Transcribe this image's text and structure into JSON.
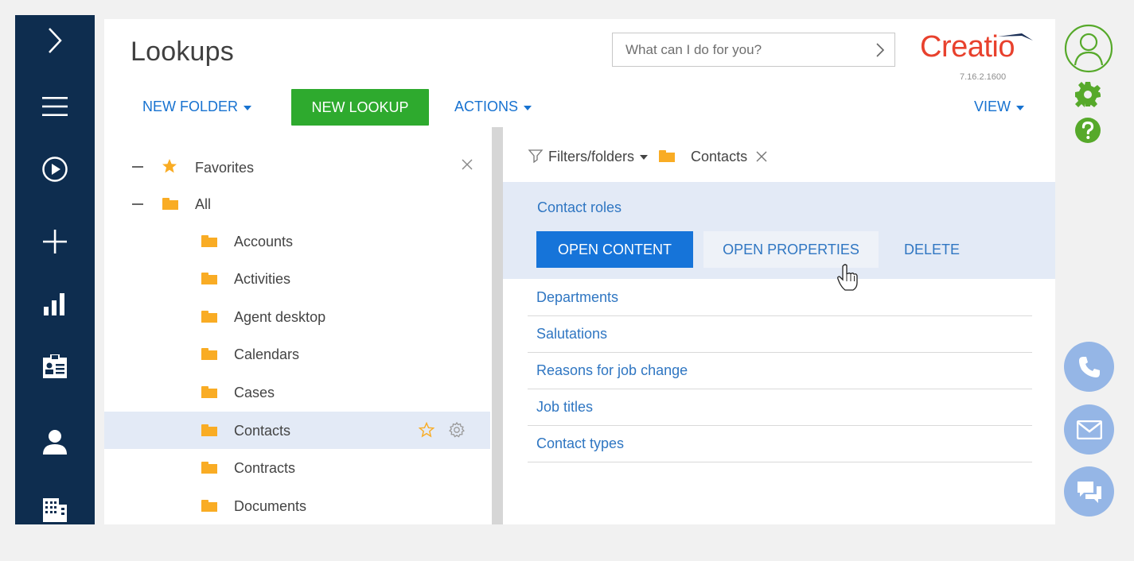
{
  "sidebar_left": {
    "items": [
      {
        "icon": "chevron-right-icon"
      },
      {
        "icon": "hamburger-menu-icon"
      },
      {
        "icon": "play-circle-icon"
      },
      {
        "icon": "plus-icon"
      },
      {
        "icon": "bar-chart-icon"
      },
      {
        "icon": "id-badge-icon"
      },
      {
        "icon": "person-icon"
      },
      {
        "icon": "building-icon"
      }
    ]
  },
  "header": {
    "title": "Lookups",
    "search_placeholder": "What can I do for you?",
    "logo_text": "Creatio",
    "version": "7.16.2.1600"
  },
  "toolbar": {
    "new_folder": "NEW FOLDER",
    "new_lookup": "NEW LOOKUP",
    "actions": "ACTIONS",
    "view": "VIEW"
  },
  "tree": {
    "favorites": "Favorites",
    "all": "All",
    "folders": [
      "Accounts",
      "Activities",
      "Agent desktop",
      "Calendars",
      "Cases",
      "Contacts",
      "Contracts",
      "Documents"
    ],
    "selected_folder": "Contacts"
  },
  "filter": {
    "label": "Filters/folders",
    "active_folder": "Contacts"
  },
  "lookups": {
    "selected": {
      "name": "Contact roles",
      "open_content": "OPEN CONTENT",
      "open_properties": "OPEN PROPERTIES",
      "delete": "DELETE"
    },
    "items": [
      "Departments",
      "Salutations",
      "Reasons for job change",
      "Job titles",
      "Contact types"
    ]
  },
  "colors": {
    "sidebar": "#0e2d4f",
    "accent_blue": "#1674d9",
    "green": "#2eaa2e",
    "selection": "#e3eaf6",
    "logo_red": "#e8412d"
  }
}
